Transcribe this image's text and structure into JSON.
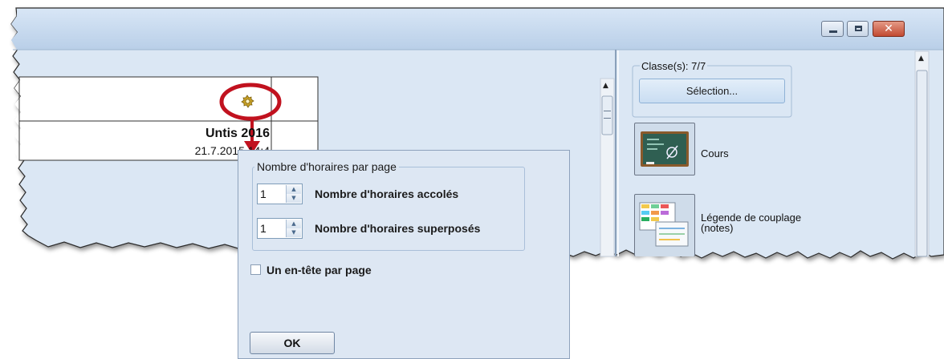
{
  "window": {
    "buttons": {
      "minimize": "minimize-icon",
      "maximize": "maximize-icon",
      "close": "close-icon"
    }
  },
  "preview": {
    "title": "Untis 2016",
    "date": "21.7.2015 14:4",
    "settings_icon": "gear-icon"
  },
  "side_panel": {
    "classes_label": "Classe(s): 7/7",
    "selection_button": "Sélection...",
    "items": [
      {
        "label": "Cours",
        "icon": "blackboard-icon"
      },
      {
        "label": "Légende de couplage\n(notes)",
        "icon": "timetable-legend-icon"
      }
    ]
  },
  "popup": {
    "group_title": "Nombre d'horaires par page",
    "rows": [
      {
        "value": "1",
        "label": "Nombre d'horaires accolés"
      },
      {
        "value": "1",
        "label": "Nombre d'horaires superposés"
      }
    ],
    "checkbox": {
      "label": "Un en-tête par page",
      "checked": false
    },
    "ok_label": "OK"
  },
  "colors": {
    "title_bar": "#c9dcf0",
    "panel_bg": "#dce8f5",
    "annotation_red": "#c1121f"
  }
}
